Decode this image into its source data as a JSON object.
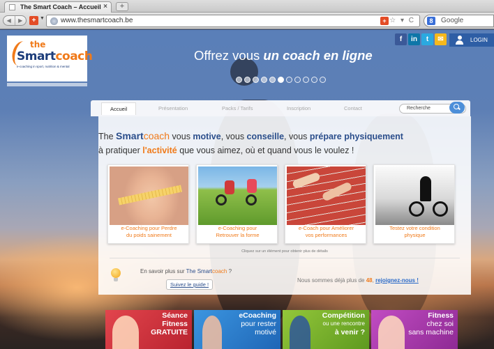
{
  "browser": {
    "tab_title": "The Smart Coach – Accueil",
    "tab_close": "×",
    "new_tab": "+",
    "url": "www.thesmartcoach.be",
    "url_controls": "☆ ▾ C",
    "search_engine": "Google",
    "back": "◀",
    "forward": "▶"
  },
  "site": {
    "logo": {
      "the": "the",
      "smart": "Smart",
      "coach": "coach",
      "tagline": "e-coaching in sport, nutrition & mental"
    },
    "login_label": "LOGIN",
    "social": [
      {
        "icon": "f",
        "color": "#3b5998"
      },
      {
        "icon": "in",
        "color": "#0e76a8"
      },
      {
        "icon": "t",
        "color": "#2aa9e0"
      },
      {
        "icon": "✉",
        "color": "#f6b81c"
      }
    ],
    "hero": {
      "prefix": "Offrez vous ",
      "emphasis": "un coach en ligne"
    },
    "nav": {
      "items": [
        "Accueil",
        "Présentation",
        "Packs / Tarifs",
        "Inscription",
        "Contact"
      ],
      "search_placeholder": "Recherche"
    },
    "intro": {
      "the": "The ",
      "smart": "Smart",
      "coach": "coach",
      "t1": " vous ",
      "b1": "motive",
      "t2": ", vous ",
      "b2": "conseille",
      "t3": ", vous ",
      "b3": "prépare physiquement",
      "line2_a": "à pratiquer ",
      "line2_b": "l'activité",
      "line2_c": " que vous aimez, où et quand vous le voulez !"
    },
    "cards": [
      {
        "line1": "e-Coaching pour Perdre",
        "line2": "du poids sainement"
      },
      {
        "line1": "e-Coaching pour",
        "line2": "Retrouver la forme"
      },
      {
        "line1": "e-Coach pour Améliorer",
        "line2": "vos performances"
      },
      {
        "line1": "Testez votre condition",
        "line2": "physique"
      }
    ],
    "hint": "Cliquez sur un élément pour obtenir plus de détails",
    "learn_more": {
      "prefix": "En savoir plus sur ",
      "the": "The ",
      "smart": "Smart",
      "coach": "coach",
      "suffix": " ?"
    },
    "guide_button": "Suivez le guide !",
    "members": {
      "prefix": "Nous sommes déjà plus de ",
      "count": "48",
      "sep": ", ",
      "join": "rejoignez-nous !"
    },
    "banners": [
      {
        "l1": "Séance",
        "l2": "Fitness",
        "l3": "GRATUITE",
        "color": "#d63a44"
      },
      {
        "l1": "eCoaching",
        "l2": "pour rester",
        "l3": "motivé",
        "color": "#2e82d2"
      },
      {
        "l1": "Compétition",
        "l2": "ou une rencontre",
        "l3": "à venir ?",
        "color": "#7fb62c"
      },
      {
        "l1": "Fitness",
        "l2": "chez soi",
        "l3": "sans machine",
        "color": "#b640b8"
      }
    ]
  }
}
